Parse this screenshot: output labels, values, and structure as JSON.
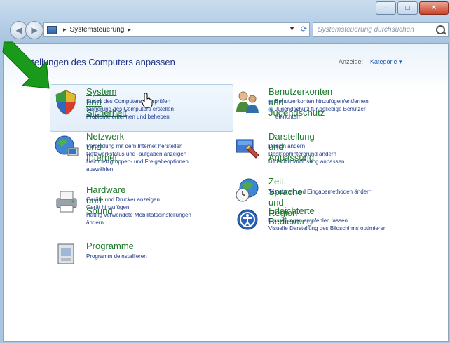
{
  "window": {
    "buttons": {
      "minimize": "–",
      "maximize": "□",
      "close": "✕"
    }
  },
  "nav": {
    "breadcrumb": "Systemsteuerung",
    "search_placeholder": "Systemsteuerung durchsuchen"
  },
  "main": {
    "title": "Einstellungen des Computers anpassen",
    "view_label": "Anzeige:",
    "view_value": "Kategorie"
  },
  "categories": [
    {
      "title": "System und Sicherheit",
      "links": [
        "Status des Computers überprüfen",
        "Sicherung des Computers erstellen",
        "Probleme erkennen und beheben"
      ]
    },
    {
      "title": "Netzwerk und Internet",
      "links": [
        "Verbindung mit dem Internet herstellen",
        "Netzwerkstatus und -aufgaben anzeigen",
        "Heimnetzgruppen- und Freigabeoptionen",
        "auswählen"
      ]
    },
    {
      "title": "Hardware und Sound",
      "links": [
        "Geräte und Drucker anzeigen",
        "Gerät hinzufügen",
        "Häufig verwendete Mobilitätseinstellungen",
        "ändern"
      ]
    },
    {
      "title": "Programme",
      "links": [
        "Programm deinstallieren"
      ]
    },
    {
      "title": "Benutzerkonten und Jugendschutz",
      "links": [
        "Benutzerkonten hinzufügen/entfernen",
        "Jugendschutz für beliebige Benutzer",
        "einrichten"
      ]
    },
    {
      "title": "Darstellung und Anpassung",
      "links": [
        "Design ändern",
        "Desktophintergrund ändern",
        "Bildschirmauflösung anpassen"
      ]
    },
    {
      "title": "Zeit, Sprache und Region",
      "links": [
        "Tastaturen und Eingabemethoden ändern"
      ]
    },
    {
      "title": "Erleichterte Bedienung",
      "links": [
        "Einstellungen empfehlen lassen",
        "Visuelle Darstellung des Bildschirms optimieren"
      ]
    }
  ]
}
